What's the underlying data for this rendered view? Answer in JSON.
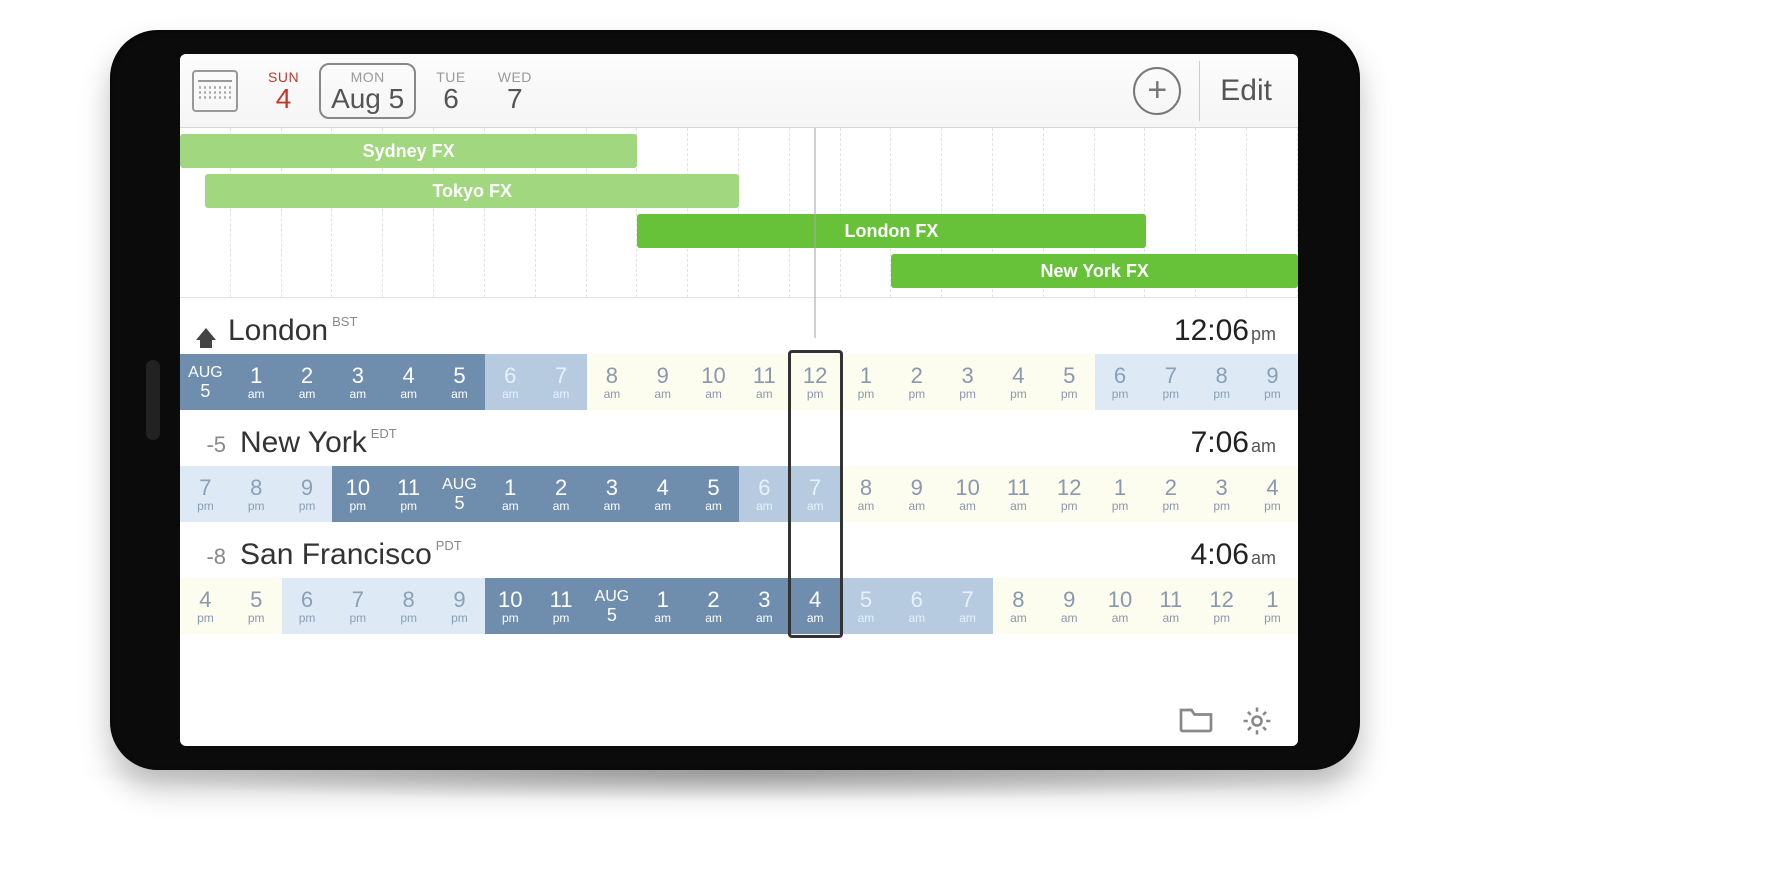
{
  "toolbar": {
    "edit_label": "Edit",
    "days": [
      {
        "dow": "SUN",
        "num": "4",
        "sun": true,
        "sel": false
      },
      {
        "dow": "MON",
        "num": "Aug 5",
        "sun": false,
        "sel": true
      },
      {
        "dow": "TUE",
        "num": "6",
        "sun": false,
        "sel": false
      },
      {
        "dow": "WED",
        "num": "7",
        "sun": false,
        "sel": false
      }
    ]
  },
  "sessions": [
    {
      "name": "Sydney FX",
      "shade": "light",
      "start": 0,
      "end": 9,
      "row": 0
    },
    {
      "name": "Tokyo FX",
      "shade": "light",
      "start": 0.5,
      "end": 11,
      "row": 1
    },
    {
      "name": "London FX",
      "shade": "dark",
      "start": 9,
      "end": 19,
      "row": 2
    },
    {
      "name": "New York FX",
      "shade": "dark",
      "start": 14,
      "end": 22,
      "row": 3
    }
  ],
  "now_index": 12,
  "cities": [
    {
      "home": true,
      "offset": "",
      "name": "London",
      "tz": "BST",
      "time": "12:06",
      "ampm": "pm",
      "hours": [
        {
          "kind": "date",
          "top": "AUG",
          "bot": "5"
        },
        {
          "kind": "night",
          "n": "1",
          "a": "am"
        },
        {
          "kind": "night",
          "n": "2",
          "a": "am"
        },
        {
          "kind": "night",
          "n": "3",
          "a": "am"
        },
        {
          "kind": "night",
          "n": "4",
          "a": "am"
        },
        {
          "kind": "night",
          "n": "5",
          "a": "am"
        },
        {
          "kind": "dawn",
          "n": "6",
          "a": "am"
        },
        {
          "kind": "dawn",
          "n": "7",
          "a": "am"
        },
        {
          "kind": "day",
          "n": "8",
          "a": "am"
        },
        {
          "kind": "day",
          "n": "9",
          "a": "am"
        },
        {
          "kind": "day",
          "n": "10",
          "a": "am"
        },
        {
          "kind": "day",
          "n": "11",
          "a": "am"
        },
        {
          "kind": "day",
          "n": "12",
          "a": "pm"
        },
        {
          "kind": "day",
          "n": "1",
          "a": "pm"
        },
        {
          "kind": "day",
          "n": "2",
          "a": "pm"
        },
        {
          "kind": "day",
          "n": "3",
          "a": "pm"
        },
        {
          "kind": "day",
          "n": "4",
          "a": "pm"
        },
        {
          "kind": "day",
          "n": "5",
          "a": "pm"
        },
        {
          "kind": "dusk",
          "n": "6",
          "a": "pm"
        },
        {
          "kind": "dusk",
          "n": "7",
          "a": "pm"
        },
        {
          "kind": "dusk",
          "n": "8",
          "a": "pm"
        },
        {
          "kind": "dusk",
          "n": "9",
          "a": "pm"
        }
      ]
    },
    {
      "home": false,
      "offset": "-5",
      "name": "New York",
      "tz": "EDT",
      "time": "7:06",
      "ampm": "am",
      "hours": [
        {
          "kind": "dusk",
          "n": "7",
          "a": "pm"
        },
        {
          "kind": "dusk",
          "n": "8",
          "a": "pm"
        },
        {
          "kind": "dusk",
          "n": "9",
          "a": "pm"
        },
        {
          "kind": "night",
          "n": "10",
          "a": "pm"
        },
        {
          "kind": "night",
          "n": "11",
          "a": "pm"
        },
        {
          "kind": "date",
          "top": "AUG",
          "bot": "5"
        },
        {
          "kind": "night",
          "n": "1",
          "a": "am"
        },
        {
          "kind": "night",
          "n": "2",
          "a": "am"
        },
        {
          "kind": "night",
          "n": "3",
          "a": "am"
        },
        {
          "kind": "night",
          "n": "4",
          "a": "am"
        },
        {
          "kind": "night",
          "n": "5",
          "a": "am"
        },
        {
          "kind": "dawn",
          "n": "6",
          "a": "am"
        },
        {
          "kind": "dawn",
          "n": "7",
          "a": "am"
        },
        {
          "kind": "day",
          "n": "8",
          "a": "am"
        },
        {
          "kind": "day",
          "n": "9",
          "a": "am"
        },
        {
          "kind": "day",
          "n": "10",
          "a": "am"
        },
        {
          "kind": "day",
          "n": "11",
          "a": "am"
        },
        {
          "kind": "day",
          "n": "12",
          "a": "pm"
        },
        {
          "kind": "day",
          "n": "1",
          "a": "pm"
        },
        {
          "kind": "day",
          "n": "2",
          "a": "pm"
        },
        {
          "kind": "day",
          "n": "3",
          "a": "pm"
        },
        {
          "kind": "day",
          "n": "4",
          "a": "pm"
        }
      ]
    },
    {
      "home": false,
      "offset": "-8",
      "name": "San Francisco",
      "tz": "PDT",
      "time": "4:06",
      "ampm": "am",
      "hours": [
        {
          "kind": "day",
          "n": "4",
          "a": "pm"
        },
        {
          "kind": "day",
          "n": "5",
          "a": "pm"
        },
        {
          "kind": "dusk",
          "n": "6",
          "a": "pm"
        },
        {
          "kind": "dusk",
          "n": "7",
          "a": "pm"
        },
        {
          "kind": "dusk",
          "n": "8",
          "a": "pm"
        },
        {
          "kind": "dusk",
          "n": "9",
          "a": "pm"
        },
        {
          "kind": "night",
          "n": "10",
          "a": "pm"
        },
        {
          "kind": "night",
          "n": "11",
          "a": "pm"
        },
        {
          "kind": "date",
          "top": "AUG",
          "bot": "5"
        },
        {
          "kind": "night",
          "n": "1",
          "a": "am"
        },
        {
          "kind": "night",
          "n": "2",
          "a": "am"
        },
        {
          "kind": "night",
          "n": "3",
          "a": "am"
        },
        {
          "kind": "night",
          "n": "4",
          "a": "am"
        },
        {
          "kind": "dawn",
          "n": "5",
          "a": "am"
        },
        {
          "kind": "dawn",
          "n": "6",
          "a": "am"
        },
        {
          "kind": "dawn",
          "n": "7",
          "a": "am"
        },
        {
          "kind": "day",
          "n": "8",
          "a": "am"
        },
        {
          "kind": "day",
          "n": "9",
          "a": "am"
        },
        {
          "kind": "day",
          "n": "10",
          "a": "am"
        },
        {
          "kind": "day",
          "n": "11",
          "a": "am"
        },
        {
          "kind": "day",
          "n": "12",
          "a": "pm"
        },
        {
          "kind": "day",
          "n": "1",
          "a": "pm"
        }
      ]
    }
  ]
}
